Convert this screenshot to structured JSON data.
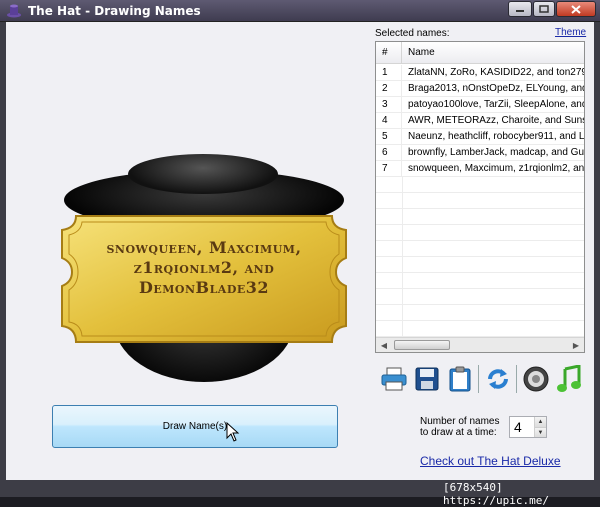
{
  "window": {
    "title": "The Hat - Drawing Names"
  },
  "ticket": {
    "text": "snowqueen, Maxcimum, z1rqionlm2, and DemonBlade32"
  },
  "selected": {
    "label": "Selected names:",
    "theme_link": "Theme"
  },
  "table": {
    "columns": [
      "#",
      "Name"
    ],
    "rows": [
      {
        "num": "1",
        "name": "ZlataNN, ZoRo, KASIDID22, and ton2799"
      },
      {
        "num": "2",
        "name": "Braga2013, nOnstOpeDz, ELYoung, and T"
      },
      {
        "num": "3",
        "name": "patoyao100love, TarZii, SleepAlone, and K"
      },
      {
        "num": "4",
        "name": "AWR, METEORAzz, Charoite, and Sunshi"
      },
      {
        "num": "5",
        "name": "Naeunz, heathcliff, robocyber911, and Liv"
      },
      {
        "num": "6",
        "name": "brownfly, LamberJack, madcap, and Guti"
      },
      {
        "num": "7",
        "name": "snowqueen, Maxcimum, z1rqionlm2, and D"
      }
    ]
  },
  "toolbar": {
    "icons": [
      "print-icon",
      "save-icon",
      "clipboard-icon",
      "refresh-icon",
      "speaker-icon",
      "music-note-icon"
    ]
  },
  "draw_button": {
    "label": "Draw Name(s)"
  },
  "names_per_draw": {
    "label": "Number of names to draw at a time:",
    "value": "4"
  },
  "deluxe": {
    "link": "Check out The Hat Deluxe"
  },
  "watermark": {
    "text": "[678x540] https://upic.me/"
  }
}
